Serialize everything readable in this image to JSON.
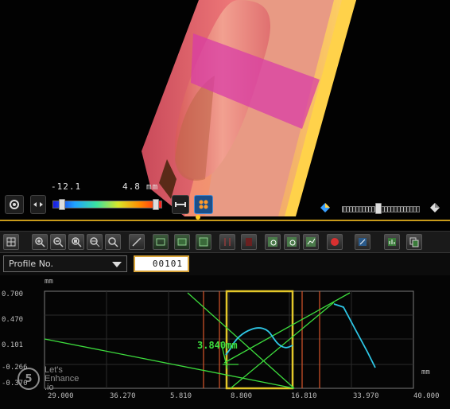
{
  "viewport": {
    "colorbar_min": "-12.1",
    "colorbar_max": "4.8",
    "colorbar_unit": "mm"
  },
  "toolbar": {
    "buttons": [
      {
        "icon": "profile-grid-icon"
      },
      {
        "icon": "zoom-in-icon"
      },
      {
        "icon": "zoom-out-icon"
      },
      {
        "icon": "zoom-area-icon"
      },
      {
        "icon": "zoom-fit-icon"
      },
      {
        "icon": "zoom-reset-icon"
      },
      {
        "icon": "measure-point-icon"
      },
      {
        "icon": "measure-line-icon"
      },
      {
        "icon": "measure-area-icon"
      },
      {
        "icon": "bracket-icon"
      },
      {
        "icon": "marker-icon"
      },
      {
        "icon": "search-plot-icon"
      },
      {
        "icon": "search-table-icon"
      },
      {
        "icon": "search-chart-icon"
      },
      {
        "icon": "record-icon"
      },
      {
        "icon": "export-icon"
      },
      {
        "icon": "chart-icon"
      },
      {
        "icon": "copy-icon"
      }
    ]
  },
  "profile": {
    "select_label": "Profile No.",
    "number_value": "00101"
  },
  "chart": {
    "unit_label": "mm",
    "y_ticks": [
      "0.700",
      "0.470",
      "0.101",
      "-0.266",
      "-0.370"
    ],
    "x_ticks": [
      "29.000",
      "36.270",
      "5.810",
      "8.800",
      "16.810",
      "33.970",
      "40.000"
    ],
    "measurement_label": "3.840mm",
    "x_unit": "mm",
    "colors": {
      "profile": "#2ec7e6",
      "measure_lines": "#3ddc3d",
      "selection": "#e3c72a",
      "markers": "#e0552a"
    }
  },
  "watermark": {
    "symbol": "5",
    "line1": "Let's",
    "line2": "Enhance",
    "line3": ".io"
  }
}
